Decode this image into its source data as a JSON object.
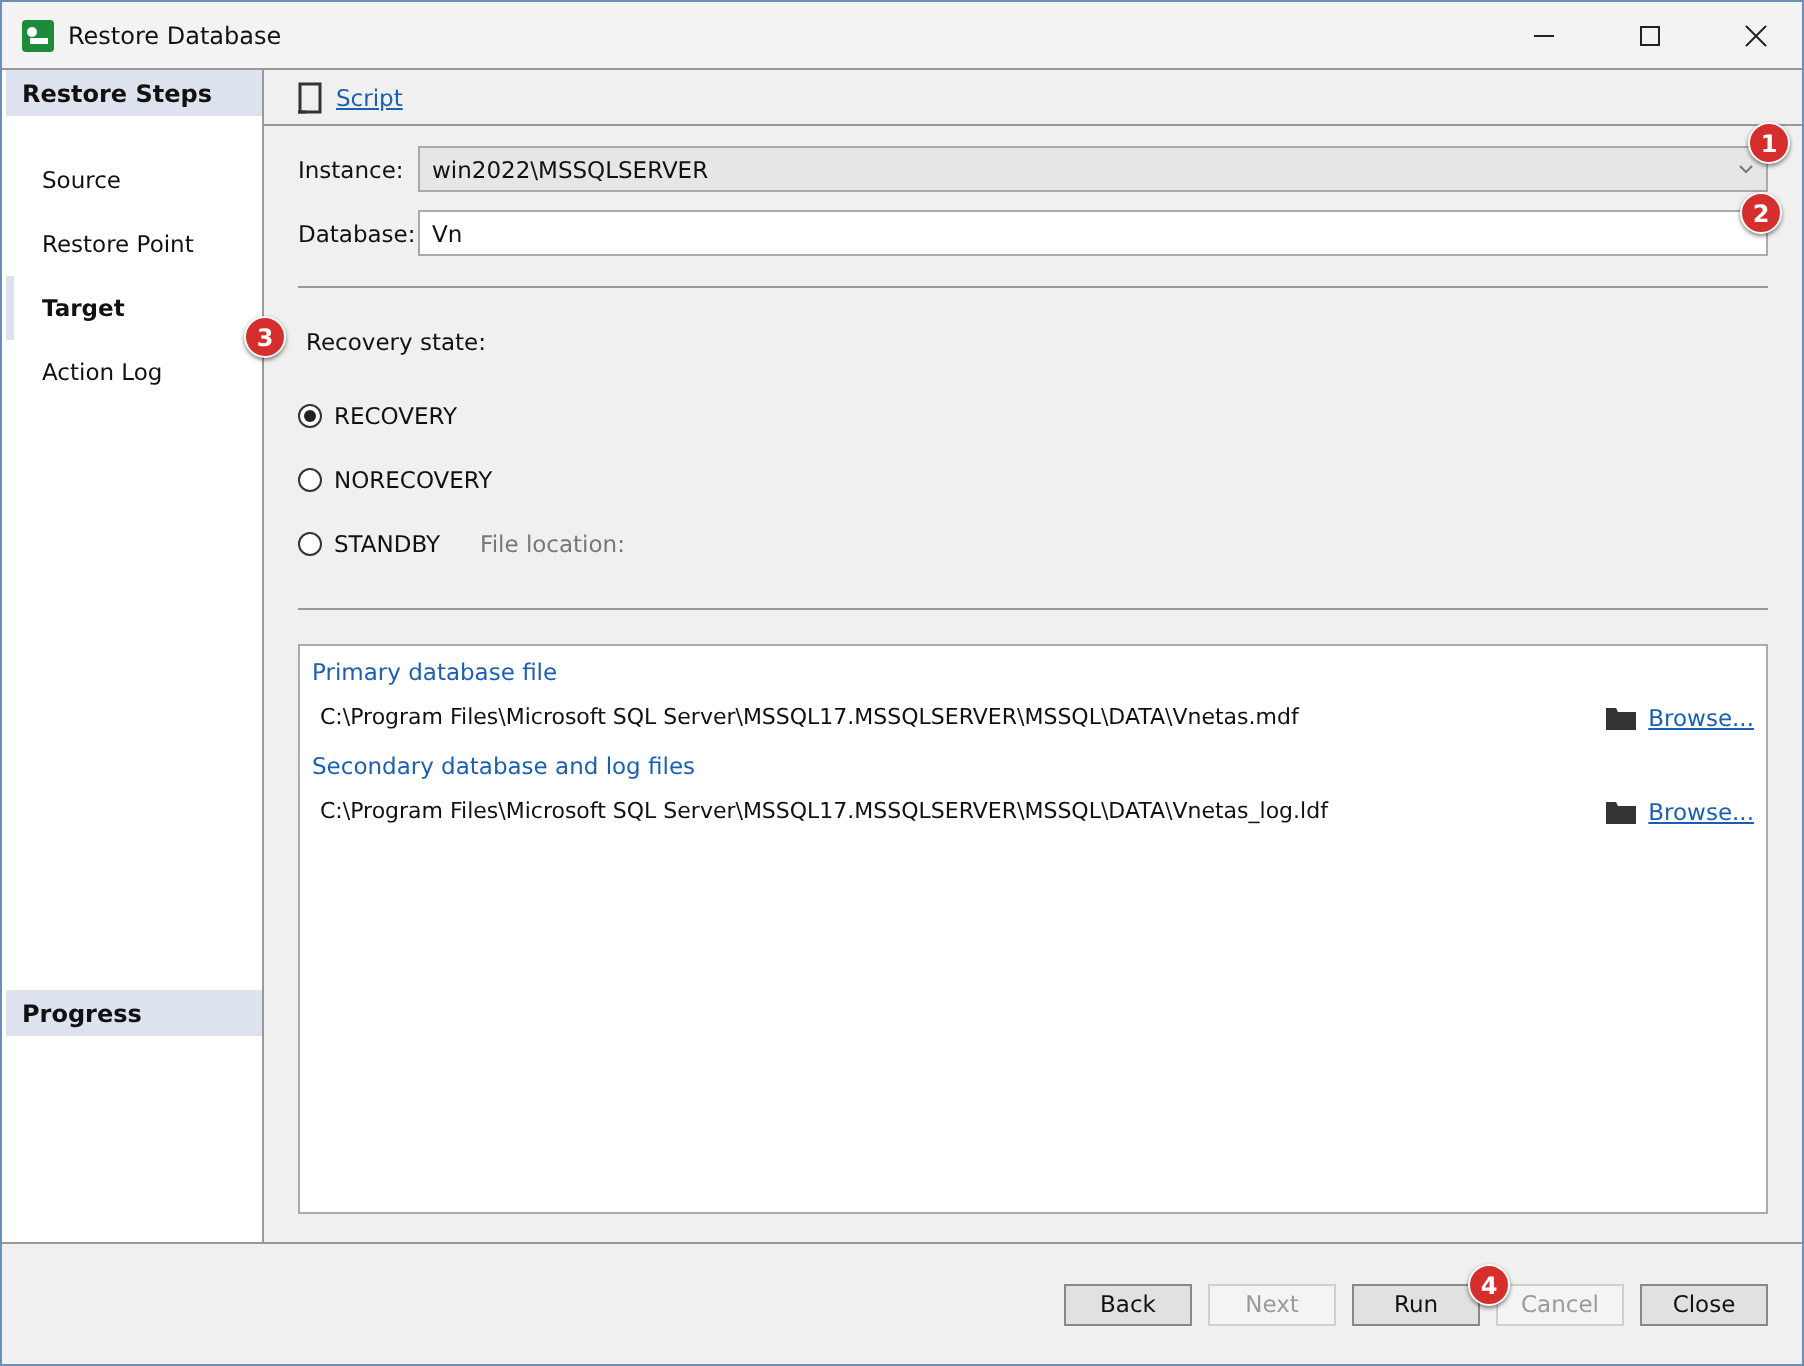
{
  "window": {
    "title": "Restore Database"
  },
  "sidebar": {
    "header": "Restore Steps",
    "items": [
      {
        "label": "Source",
        "selected": false
      },
      {
        "label": "Restore Point",
        "selected": false
      },
      {
        "label": "Target",
        "selected": true
      },
      {
        "label": "Action Log",
        "selected": false
      }
    ],
    "progress_header": "Progress"
  },
  "toolbar": {
    "script": "Script"
  },
  "instance": {
    "label": "Instance:",
    "value": "win2022\\MSSQLSERVER"
  },
  "database": {
    "label": "Database:",
    "value": "Vn"
  },
  "recovery": {
    "label": "Recovery state:",
    "options": [
      {
        "label": "RECOVERY",
        "selected": true
      },
      {
        "label": "NORECOVERY",
        "selected": false
      },
      {
        "label": "STANDBY",
        "selected": false
      }
    ],
    "file_location": "File location:"
  },
  "files": [
    {
      "title": "Primary database file",
      "path": "C:\\Program Files\\Microsoft SQL Server\\MSSQL17.MSSQLSERVER\\MSSQL\\DATA\\Vnetas.mdf",
      "browse": "Browse..."
    },
    {
      "title": "Secondary database and log files",
      "path": "C:\\Program Files\\Microsoft SQL Server\\MSSQL17.MSSQLSERVER\\MSSQL\\DATA\\Vnetas_log.ldf",
      "browse": "Browse..."
    }
  ],
  "buttons": [
    {
      "label": "Back",
      "disabled": false
    },
    {
      "label": "Next",
      "disabled": true
    },
    {
      "label": "Run",
      "disabled": false
    },
    {
      "label": "Cancel",
      "disabled": true
    },
    {
      "label": "Close",
      "disabled": false
    }
  ],
  "callouts": [
    "1",
    "2",
    "3",
    "4"
  ]
}
